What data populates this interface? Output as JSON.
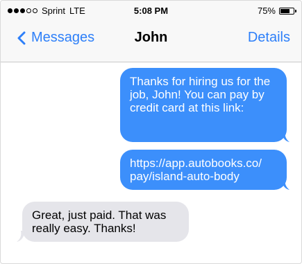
{
  "status_bar": {
    "carrier": "Sprint",
    "network": "LTE",
    "time": "5:08 PM",
    "battery": "75%",
    "battery_level": 0.75,
    "signal_filled": 3,
    "signal_total": 5
  },
  "nav": {
    "back_label": "Messages",
    "title": "John",
    "details_label": "Details"
  },
  "messages": [
    {
      "direction": "sent",
      "text": "Thanks for hiring us for the job, John! You can pay by credit card at this link:"
    },
    {
      "direction": "sent",
      "text": "https://app.autobooks.co/\npay/island-auto-body"
    },
    {
      "direction": "received",
      "text": "Great, just paid. That was really easy. Thanks!"
    }
  ],
  "colors": {
    "accent": "#2d7ff9",
    "sent_bubble": "#3c8ffb",
    "received_bubble": "#e5e5ea",
    "header_bg": "#f8f8f8"
  }
}
